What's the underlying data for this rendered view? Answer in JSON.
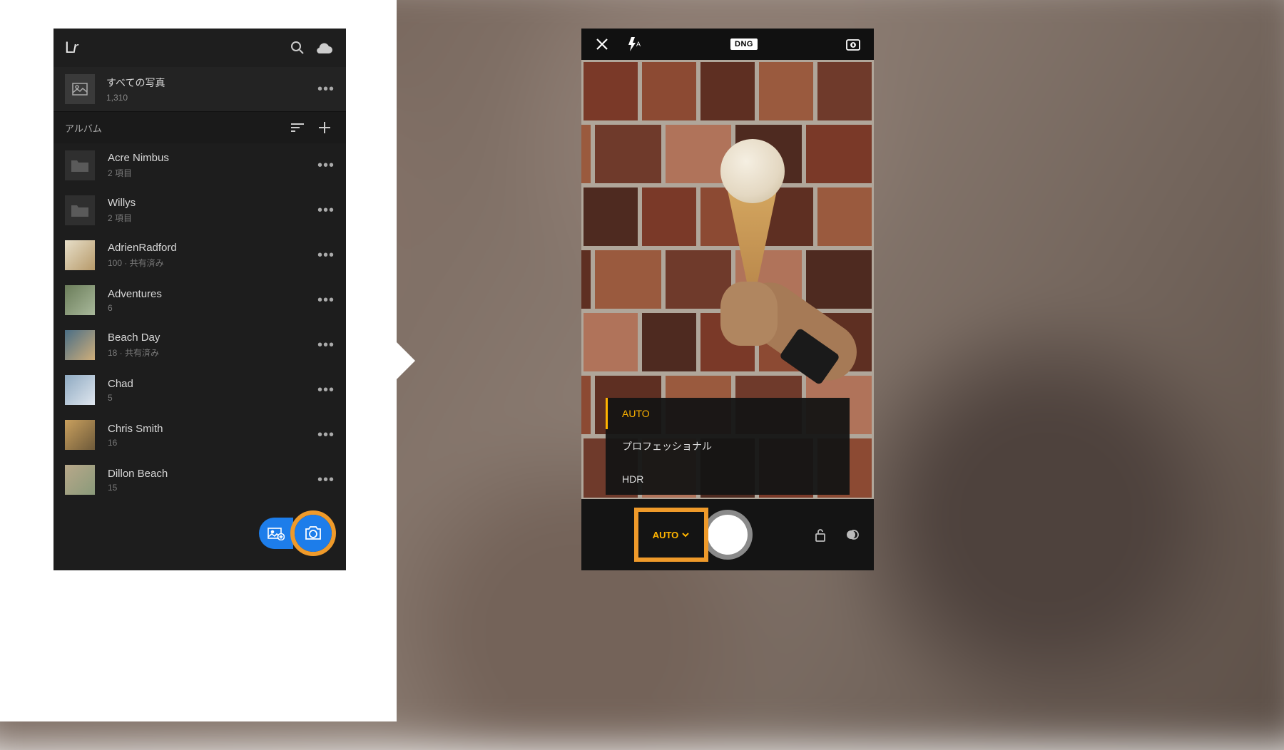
{
  "left": {
    "logo": "Lr",
    "all_photos_label": "すべての写真",
    "all_photos_count": "1,310",
    "albums_header": "アルバム",
    "items": [
      {
        "type": "folder",
        "name": "Acre Nimbus",
        "meta": "2 項目"
      },
      {
        "type": "folder",
        "name": "Willys",
        "meta": "2 項目"
      },
      {
        "type": "album",
        "name": "AdrienRadford",
        "meta": "100 · 共有済み",
        "c1": "#e7dfc9",
        "c2": "#b79a6a"
      },
      {
        "type": "album",
        "name": "Adventures",
        "meta": "6",
        "c1": "#6b7d5a",
        "c2": "#a8b89a"
      },
      {
        "type": "album",
        "name": "Beach Day",
        "meta": "18 · 共有済み",
        "c1": "#4a6e86",
        "c2": "#cfae7a"
      },
      {
        "type": "album",
        "name": "Chad",
        "meta": "5",
        "c1": "#8faac2",
        "c2": "#dfe6ee"
      },
      {
        "type": "album",
        "name": "Chris Smith",
        "meta": "16",
        "c1": "#c9a05e",
        "c2": "#6e5a3a"
      },
      {
        "type": "album",
        "name": "Dillon Beach",
        "meta": "15",
        "c1": "#b8a88a",
        "c2": "#8a9a7a"
      }
    ]
  },
  "right": {
    "dng_badge": "DNG",
    "modes": [
      {
        "label": "AUTO",
        "active": true
      },
      {
        "label": "プロフェッショナル",
        "active": false
      },
      {
        "label": "HDR",
        "active": false
      }
    ],
    "mode_button_label": "AUTO"
  }
}
